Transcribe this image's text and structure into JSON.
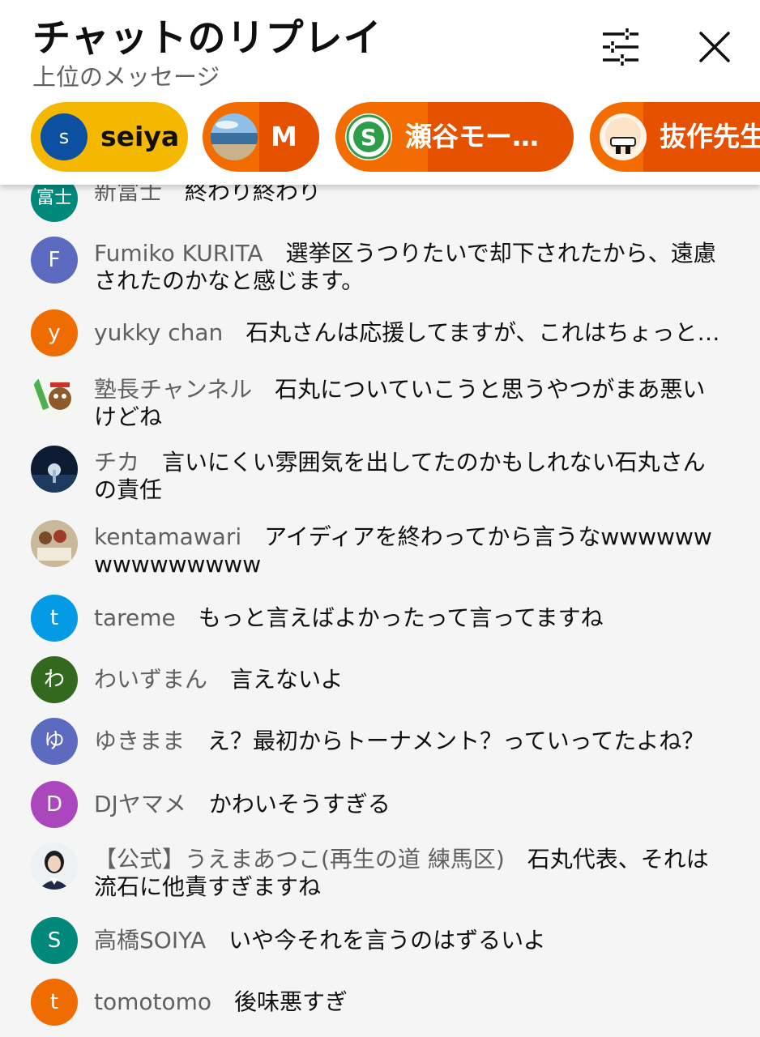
{
  "header": {
    "title": "チャットのリプレイ",
    "subtitle": "上位のメッセージ",
    "filter_icon": "sliders-icon",
    "close_icon": "close-icon"
  },
  "chips": [
    {
      "name": "seiya",
      "avatar_letter": "s",
      "avatar_color": "#0d4fa0",
      "left_color": "#f5b800",
      "right_color": "#f5b800"
    },
    {
      "name": "M",
      "avatar": "beach-photo",
      "left_color": "#f26c00",
      "right_color": "#e65100"
    },
    {
      "name": "瀬谷モー…",
      "avatar": "green-s-logo",
      "left_color": "#f26c00",
      "right_color": "#e65100"
    },
    {
      "name": "抜作先生",
      "avatar": "cartoon-face",
      "left_color": "#f26c00",
      "right_color": "#e65100"
    }
  ],
  "messages": [
    {
      "author": "新富士",
      "text": "終わり終わり",
      "avatar_text": "富士",
      "avatar_color": "#00897b"
    },
    {
      "author": "Fumiko KURITA",
      "text": "選挙区うつりたいで却下されたから、遠慮されたのかなと感じます。",
      "avatar_text": "F",
      "avatar_color": "#5c6bc0"
    },
    {
      "author": "yukky chan",
      "text": "石丸さんは応援してますが、これはちょっと…",
      "avatar_text": "y",
      "avatar_color": "#ef6c00"
    },
    {
      "author": "塾長チャンネル",
      "text": "石丸についていこうと思うやつがまあ悪いけどね",
      "avatar": "character-image"
    },
    {
      "author": "チカ",
      "text": "言いにくい雰囲気を出してたのかもしれない石丸さんの責任",
      "avatar": "night-lighthouse-photo"
    },
    {
      "author": "kentamawari",
      "text": "アイディアを終わってから言うなwwwwwwwwwwwwwww",
      "avatar": "group-photo"
    },
    {
      "author": "tareme",
      "text": "もっと言えばよかったって言ってますね",
      "avatar_text": "t",
      "avatar_color": "#039be5"
    },
    {
      "author": "わいずまん",
      "text": "言えないよ",
      "avatar_text": "わ",
      "avatar_color": "#33691e"
    },
    {
      "author": "ゆきまま",
      "text": "え？最初からトーナメント？っていってたよね？",
      "avatar_text": "ゆ",
      "avatar_color": "#5c6bc0"
    },
    {
      "author": "DJヤマメ",
      "text": "かわいそうすぎる",
      "avatar_text": "D",
      "avatar_color": "#ab47bc"
    },
    {
      "author": "【公式】うえまあつこ(再生の道 練馬区)",
      "text": "石丸代表、それは流石に他責すぎますね",
      "avatar": "woman-portrait"
    },
    {
      "author": "高橋SOIYA",
      "text": "いや今それを言うのはずるいよ",
      "avatar_text": "S",
      "avatar_color": "#00897b"
    },
    {
      "author": "tomotomo",
      "text": "後味悪すぎ",
      "avatar_text": "t",
      "avatar_color": "#ef6c00"
    }
  ]
}
